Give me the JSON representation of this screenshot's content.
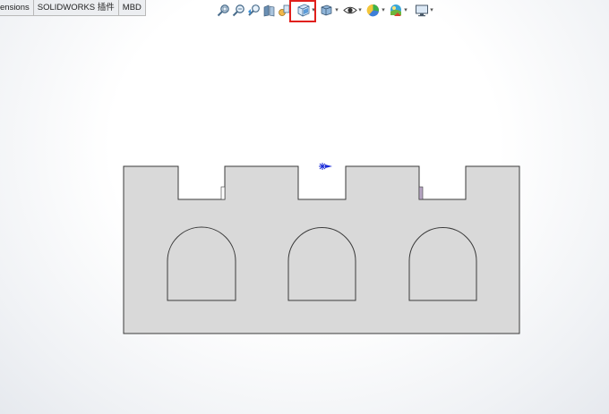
{
  "tabs": [
    {
      "label": "ensions"
    },
    {
      "label": "SOLIDWORKS 插件"
    },
    {
      "label": "MBD"
    }
  ],
  "heads_up_toolbar": {
    "buttons": [
      {
        "icon": "zoom-to-fit-icon"
      },
      {
        "icon": "zoom-to-area-icon"
      },
      {
        "icon": "previous-view-icon"
      },
      {
        "icon": "section-view-icon"
      },
      {
        "icon": "dynamic-annotation-icon"
      },
      {
        "icon": "view-orientation-icon",
        "highlighted": true
      },
      {
        "icon": "display-style-icon"
      },
      {
        "icon": "hide-show-items-icon"
      },
      {
        "icon": "edit-appearance-icon"
      },
      {
        "icon": "apply-scene-icon"
      },
      {
        "icon": "view-settings-icon"
      }
    ]
  },
  "colors": {
    "part_face": "#d9d9d9",
    "part_edge": "#3a3a3a",
    "highlight": "#e0201c",
    "triad": "#1a2bd8",
    "hidden_face": "#b7a6c4"
  }
}
